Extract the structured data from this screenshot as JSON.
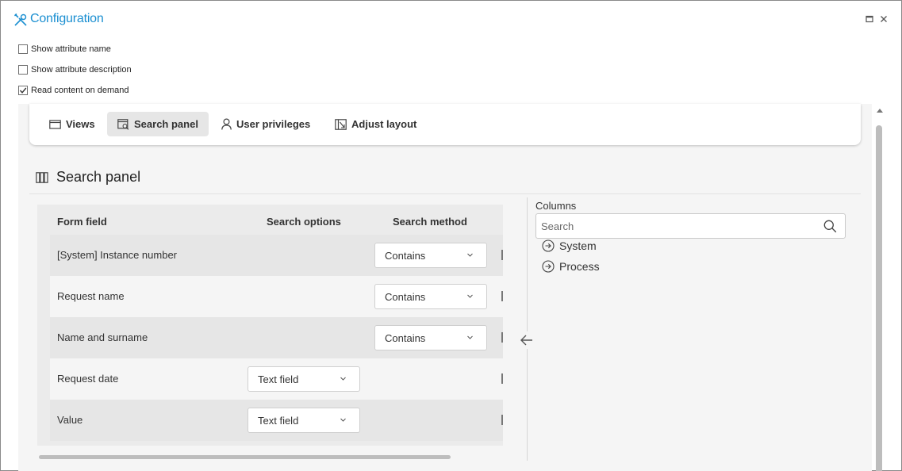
{
  "window": {
    "title": "Configuration",
    "icons": {
      "title": "tools-icon",
      "maximize": "maximize-icon",
      "close": "close-icon"
    }
  },
  "options": [
    {
      "label": "Show attribute name",
      "checked": false
    },
    {
      "label": "Show attribute description",
      "checked": false
    },
    {
      "label": "Read content on demand",
      "checked": true
    }
  ],
  "tabs": [
    {
      "label": "Views",
      "icon": "window-icon",
      "active": false
    },
    {
      "label": "Search panel",
      "icon": "search-panel-icon",
      "active": true
    },
    {
      "label": "User privileges",
      "icon": "user-icon",
      "active": false
    },
    {
      "label": "Adjust layout",
      "icon": "layout-icon",
      "active": false
    }
  ],
  "section": {
    "title": "Search panel",
    "icon": "columns-icon"
  },
  "table": {
    "headers": [
      "Form field",
      "Search options",
      "Search method"
    ],
    "rows": [
      {
        "field": "[System] Instance number",
        "option": "",
        "method": "Contains"
      },
      {
        "field": "Request name",
        "option": "",
        "method": "Contains"
      },
      {
        "field": "Name and surname",
        "option": "",
        "method": "Contains"
      },
      {
        "field": "Request date",
        "option": "Text field",
        "method": ""
      },
      {
        "field": "Value",
        "option": "Text field",
        "method": ""
      }
    ]
  },
  "columns_panel": {
    "label": "Columns",
    "search_placeholder": "Search",
    "items": [
      {
        "label": "System",
        "icon": "arrow-circle-right-icon"
      },
      {
        "label": "Process",
        "icon": "arrow-circle-right-icon"
      }
    ]
  },
  "colors": {
    "accent": "#1b8fd1",
    "tab_active_bg": "#e6e6e6",
    "content_bg": "#f5f5f5"
  }
}
